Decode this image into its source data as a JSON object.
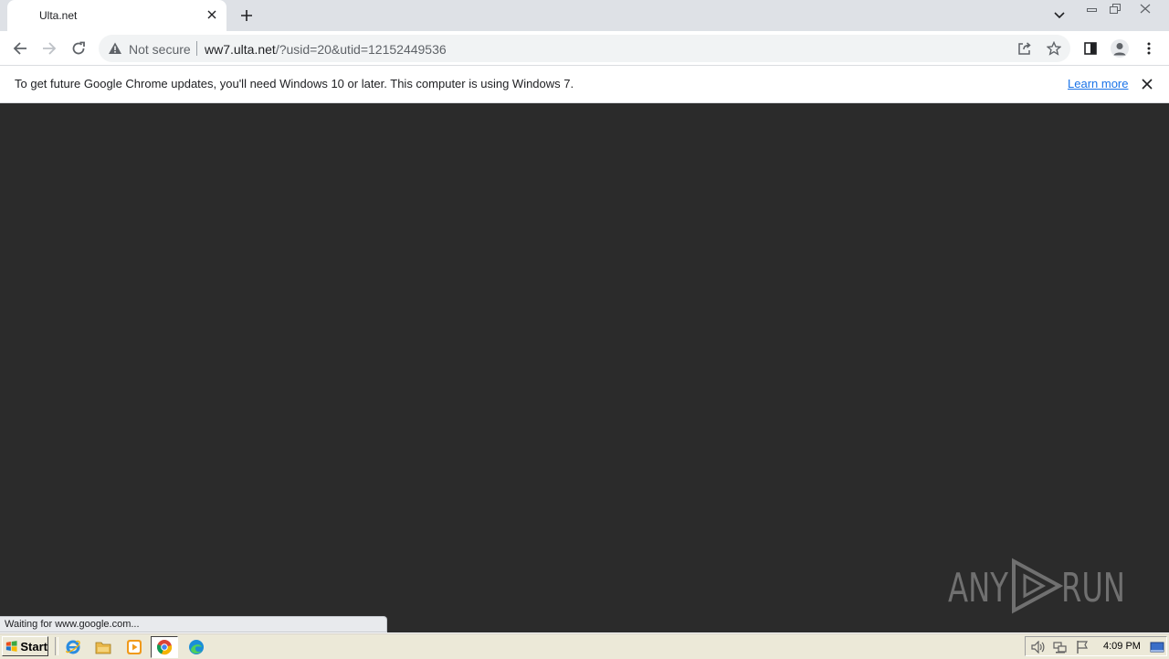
{
  "browser": {
    "tab": {
      "title": "Ulta.net"
    },
    "omnibox": {
      "security_label": "Not secure",
      "url_host": "ww7.ulta.net",
      "url_path": "/?usid=20&utid=12152449536"
    }
  },
  "infobar": {
    "message": "To get future Google Chrome updates, you'll need Windows 10 or later. This computer is using Windows 7.",
    "link_label": "Learn more"
  },
  "content": {
    "background": "#2b2b2b",
    "watermark": "ANY RUN"
  },
  "status": {
    "text": "Waiting for www.google.com..."
  },
  "taskbar": {
    "start_label": "Start",
    "quick_launch": [
      "ie-icon",
      "explorer-icon",
      "media-player-icon",
      "chrome-icon",
      "edge-icon"
    ],
    "clock": "4:09 PM"
  },
  "colors": {
    "accent": "#1a73e8",
    "tabstrip": "#dee1e6",
    "taskbar": "#ece9d8"
  }
}
